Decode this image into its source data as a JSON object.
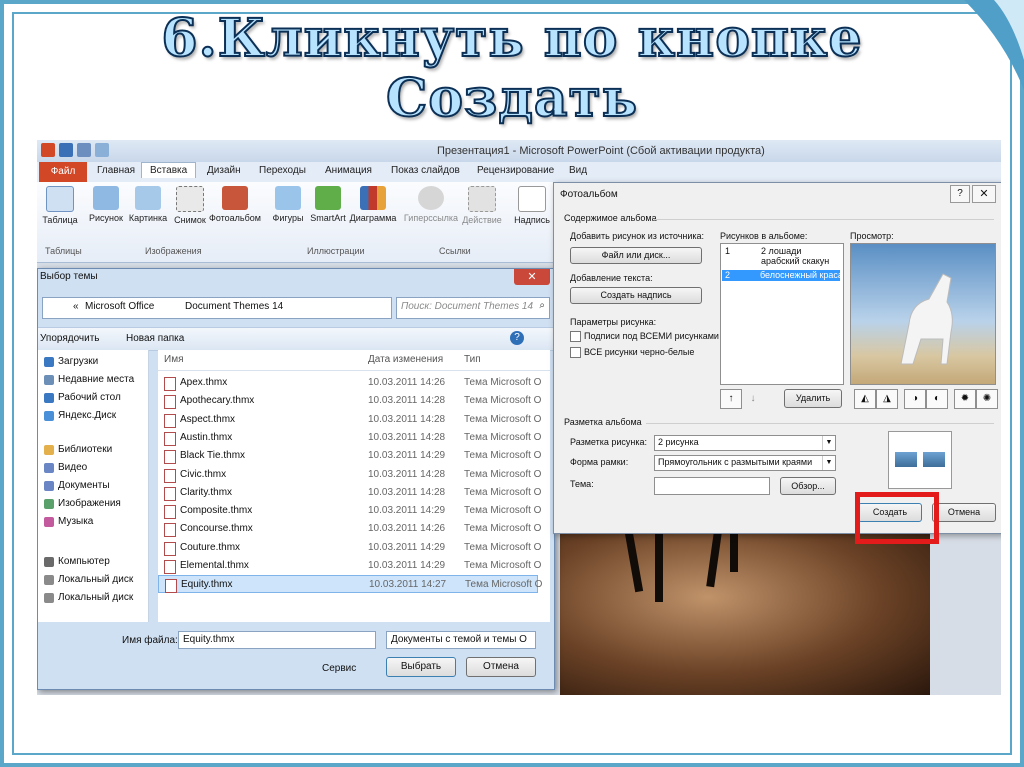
{
  "slide": {
    "title_line1": "6.Кликнуть по кнопке",
    "title_line2": "Создать"
  },
  "app": {
    "window_title": "Презентация1 - Microsoft PowerPoint (Сбой активации продукта)",
    "tabs": [
      "Файл",
      "Главная",
      "Вставка",
      "Дизайн",
      "Переходы",
      "Анимация",
      "Показ слайдов",
      "Рецензирование",
      "Вид"
    ],
    "active_tab": "Вставка",
    "ribbon_buttons": [
      "Таблица",
      "Рисунок",
      "Картинка",
      "Снимок",
      "Фотоальбом",
      "Фигуры",
      "SmartArt",
      "Диаграмма",
      "Гиперссылка",
      "Действие",
      "Надпись"
    ],
    "ribbon_groups": [
      "Таблицы",
      "Изображения",
      "Иллюстрации",
      "Ссылки"
    ]
  },
  "file_dialog": {
    "title": "Выбор темы",
    "breadcrumb": [
      "«",
      "Microsoft Office",
      "Document Themes 14"
    ],
    "search_placeholder": "Поиск: Document Themes 14",
    "organize": "Упорядочить",
    "new_folder": "Новая папка",
    "columns": [
      "Имя",
      "Дата изменения",
      "Тип"
    ],
    "nav_items": [
      "Загрузки",
      "Недавние места",
      "Рабочий стол",
      "Яндекс.Диск",
      "Библиотеки",
      "Видео",
      "Документы",
      "Изображения",
      "Музыка",
      "Компьютер",
      "Локальный диск",
      "Локальный диск"
    ],
    "files": [
      {
        "name": "Apex.thmx",
        "date": "10.03.2011 14:26",
        "type": "Тема Microsoft O"
      },
      {
        "name": "Apothecary.thmx",
        "date": "10.03.2011 14:28",
        "type": "Тема Microsoft O"
      },
      {
        "name": "Aspect.thmx",
        "date": "10.03.2011 14:28",
        "type": "Тема Microsoft O"
      },
      {
        "name": "Austin.thmx",
        "date": "10.03.2011 14:28",
        "type": "Тема Microsoft O"
      },
      {
        "name": "Black Tie.thmx",
        "date": "10.03.2011 14:29",
        "type": "Тема Microsoft O"
      },
      {
        "name": "Civic.thmx",
        "date": "10.03.2011 14:28",
        "type": "Тема Microsoft O"
      },
      {
        "name": "Clarity.thmx",
        "date": "10.03.2011 14:28",
        "type": "Тема Microsoft O"
      },
      {
        "name": "Composite.thmx",
        "date": "10.03.2011 14:29",
        "type": "Тема Microsoft O"
      },
      {
        "name": "Concourse.thmx",
        "date": "10.03.2011 14:26",
        "type": "Тема Microsoft O"
      },
      {
        "name": "Couture.thmx",
        "date": "10.03.2011 14:29",
        "type": "Тема Microsoft O"
      },
      {
        "name": "Elemental.thmx",
        "date": "10.03.2011 14:29",
        "type": "Тема Microsoft O"
      },
      {
        "name": "Equity.thmx",
        "date": "10.03.2011 14:27",
        "type": "Тема Microsoft O"
      }
    ],
    "selected_file": "Equity.thmx",
    "filename_label": "Имя файла:",
    "filename_value": "Equity.thmx",
    "filter_value": "Документы с темой и темы O",
    "service": "Сервис",
    "open_button": "Выбрать",
    "cancel_button": "Отмена"
  },
  "album_dialog": {
    "title": "Фотоальбом",
    "help": "?",
    "close": "✕",
    "content_group": "Содержимое альбома",
    "add_from_label": "Добавить рисунок из источника:",
    "file_disk_button": "Файл или диск...",
    "add_text_label": "Добавление текста:",
    "new_caption_button": "Создать надпись",
    "picture_options_label": "Параметры рисунка:",
    "captions_checkbox": "Подписи под ВСЕМИ рисунками",
    "bw_checkbox": "ВСЕ рисунки черно-белые",
    "pictures_label": "Рисунков в альбоме:",
    "pictures": [
      {
        "num": "1",
        "text": "2 лошади арабский скакун"
      },
      {
        "num": "2",
        "text": "белоснежный красав"
      }
    ],
    "remove_button": "Удалить",
    "preview_label": "Просмотр:",
    "layout_group": "Разметка альбома",
    "layout_label": "Разметка рисунка:",
    "layout_value": "2 рисунка",
    "frame_label": "Форма рамки:",
    "frame_value": "Прямоугольник с размытыми краями",
    "theme_label": "Тема:",
    "theme_value": "",
    "browse_button": "Обзор...",
    "create_button": "Создать",
    "cancel_button": "Отмена"
  },
  "colors": {
    "title_fill": "#b7e3ff",
    "title_stroke": "#0b2f55",
    "frame": "#5aa7c9",
    "highlight": "#e41b1b"
  }
}
